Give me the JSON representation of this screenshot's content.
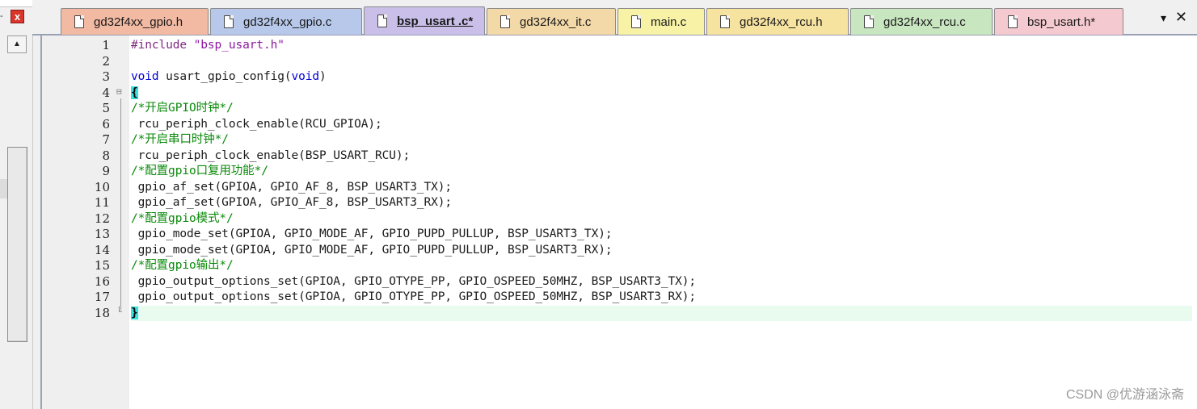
{
  "tabs": [
    {
      "label": "gd32f4xx_gpio.h",
      "color": "#f2b9a3",
      "left": 0
    },
    {
      "label": "gd32f4xx_gpio.c",
      "color": "#b7c8ea",
      "left": 0
    },
    {
      "label": "bsp_usart .c*",
      "color": "#c9bfe8",
      "active": true
    },
    {
      "label": "gd32f4xx_it.c",
      "color": "#f4d9a8"
    },
    {
      "label": "main.c",
      "color": "#f7f2a6"
    },
    {
      "label": "gd32f4xx_rcu.h",
      "color": "#f7e3a0"
    },
    {
      "label": "gd32f4xx_rcu.c",
      "color": "#c8e6bf"
    },
    {
      "label": "bsp_usart.h*",
      "color": "#f4c9cf"
    }
  ],
  "tab_menu_glyph": "▾",
  "tab_close_glyph": "✕",
  "left_close_glyph": "x",
  "left_dash": "-",
  "scroll_up_glyph": "▲",
  "lines": [
    {
      "n": "1",
      "code": [
        {
          "t": "#include ",
          "c": "pre"
        },
        {
          "t": "\"bsp_usart.h\"",
          "c": "str"
        }
      ]
    },
    {
      "n": "2",
      "code": []
    },
    {
      "n": "3",
      "code": [
        {
          "t": "void",
          "c": "kw"
        },
        {
          "t": " usart_gpio_config("
        },
        {
          "t": "void",
          "c": "kw"
        },
        {
          "t": ")"
        }
      ]
    },
    {
      "n": "4",
      "fold": "⊟",
      "code": [
        {
          "t": "{",
          "c": "brace"
        }
      ]
    },
    {
      "n": "5",
      "code": [
        {
          "t": "/*开启GPIO时钟*/",
          "c": "cmt"
        }
      ]
    },
    {
      "n": "6",
      "code": [
        {
          "t": " rcu_periph_clock_enable(RCU_GPIOA);"
        }
      ]
    },
    {
      "n": "7",
      "code": [
        {
          "t": "/*开启串口时钟*/",
          "c": "cmt"
        }
      ]
    },
    {
      "n": "8",
      "code": [
        {
          "t": " rcu_periph_clock_enable(BSP_USART_RCU);"
        }
      ]
    },
    {
      "n": "9",
      "code": [
        {
          "t": "/*配置gpio口复用功能*/",
          "c": "cmt"
        }
      ]
    },
    {
      "n": "10",
      "code": [
        {
          "t": " gpio_af_set(GPIOA, GPIO_AF_8, BSP_USART3_TX);"
        }
      ]
    },
    {
      "n": "11",
      "code": [
        {
          "t": " gpio_af_set(GPIOA, GPIO_AF_8, BSP_USART3_RX);"
        }
      ]
    },
    {
      "n": "12",
      "code": [
        {
          "t": "/*配置gpio模式*/",
          "c": "cmt"
        }
      ]
    },
    {
      "n": "13",
      "code": [
        {
          "t": " gpio_mode_set(GPIOA, GPIO_MODE_AF, GPIO_PUPD_PULLUP, BSP_USART3_TX);"
        }
      ]
    },
    {
      "n": "14",
      "code": [
        {
          "t": " gpio_mode_set(GPIOA, GPIO_MODE_AF, GPIO_PUPD_PULLUP, BSP_USART3_RX);"
        }
      ]
    },
    {
      "n": "15",
      "code": [
        {
          "t": "/*配置gpio输出*/",
          "c": "cmt"
        }
      ]
    },
    {
      "n": "16",
      "code": [
        {
          "t": " gpio_output_options_set(GPIOA, GPIO_OTYPE_PP, GPIO_OSPEED_50MHZ, BSP_USART3_TX);"
        }
      ]
    },
    {
      "n": "17",
      "code": [
        {
          "t": " gpio_output_options_set(GPIOA, GPIO_OTYPE_PP, GPIO_OSPEED_50MHZ, BSP_USART3_RX);"
        }
      ]
    },
    {
      "n": "18",
      "fold": "└",
      "hl": true,
      "code": [
        {
          "t": "}",
          "c": "brace"
        }
      ]
    }
  ],
  "watermark": "CSDN @优游涵泳斋"
}
